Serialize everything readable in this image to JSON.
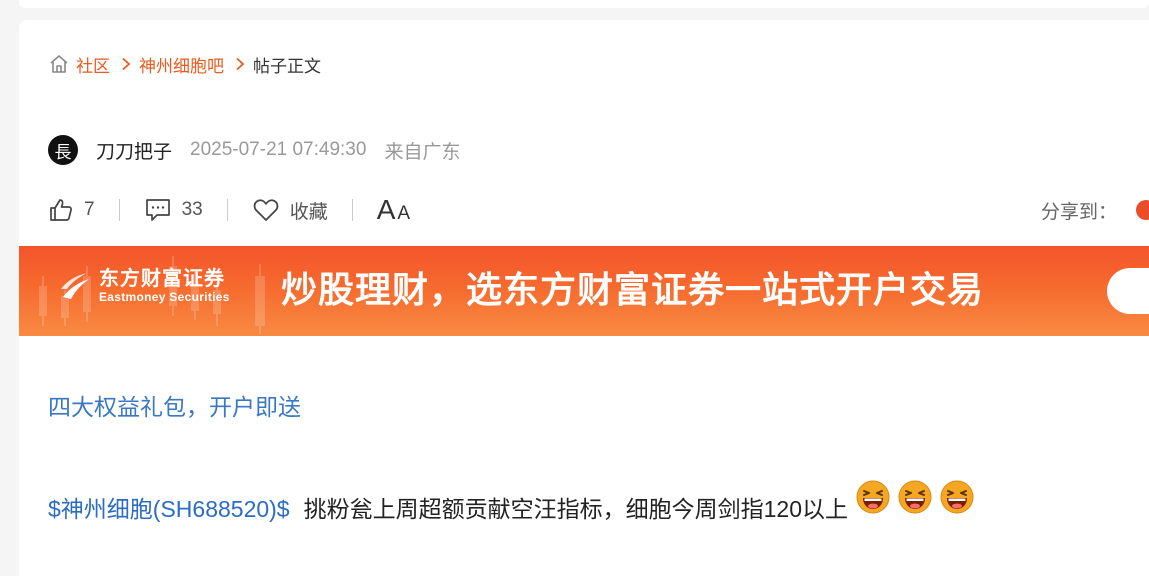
{
  "breadcrumb": {
    "home_label": "社区",
    "forum_label": "神州细胞吧",
    "current_label": "帖子正文"
  },
  "author": {
    "avatar_char": "長",
    "name": "刀刀把子",
    "time": "2025-07-21 07:49:30",
    "location": "来自广东"
  },
  "actions": {
    "like_count": "7",
    "comment_count": "33",
    "favorite_label": "收藏",
    "font_big": "A",
    "font_small": "A",
    "share_label": "分享到："
  },
  "banner": {
    "brand_cn": "东方财富证券",
    "brand_en": "Eastmoney Securities",
    "slogan": "炒股理财，选东方财富证券一站式开户交易"
  },
  "content": {
    "promo_link": "四大权益礼包，开户即送",
    "stock_tag": "$神州细胞(SH688520)$",
    "text": "挑粉瓮上周超额贡献空汪指标，细胞今周剑指120以上",
    "emojis": [
      "laughing-emoji",
      "laughing-emoji",
      "laughing-emoji"
    ]
  },
  "colors": {
    "accent_orange": "#ea5a1e",
    "link_blue": "#2b6cc4",
    "banner_orange": "#f4542b"
  }
}
